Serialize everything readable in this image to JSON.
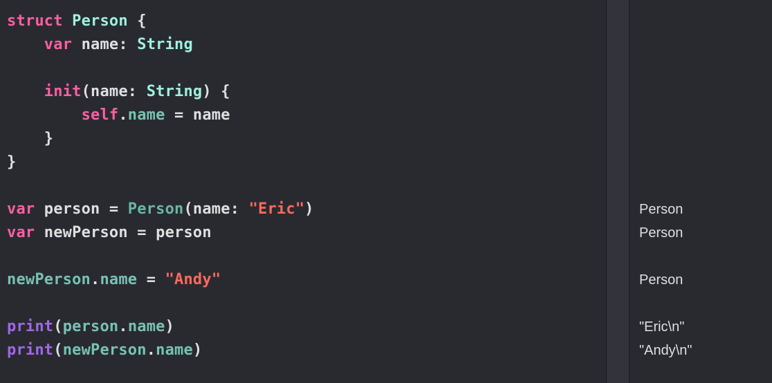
{
  "code": {
    "kw_struct": "struct",
    "type_person": "Person",
    "brace_open": " {",
    "indent1": "    ",
    "indent2": "        ",
    "kw_var": "var",
    "name_decl": " name: ",
    "type_string": "String",
    "kw_init": "init",
    "init_sig_open": "(name: ",
    "init_sig_close": ") {",
    "kw_self": "self",
    "dot": ".",
    "assign_name": "name",
    "eq_name": " = name",
    "brace_close1": "    }",
    "brace_close0": "}",
    "var_person_lhs": " person = ",
    "person_ctor": "Person",
    "ctor_open": "(name: ",
    "str_eric": "\"Eric\"",
    "ctor_close": ")",
    "var_newperson_lhs": " newPerson = person",
    "newperson_ref": "newPerson",
    "name_ref": "name",
    "eq": " = ",
    "str_andy": "\"Andy\"",
    "fn_print": "print",
    "paren_open": "(",
    "person_ref": "person",
    "paren_close": ")"
  },
  "results": {
    "r1": "Person",
    "r2": "Person",
    "r3": "Person",
    "r4": "\"Eric\\n\"",
    "r5": "\"Andy\\n\""
  }
}
